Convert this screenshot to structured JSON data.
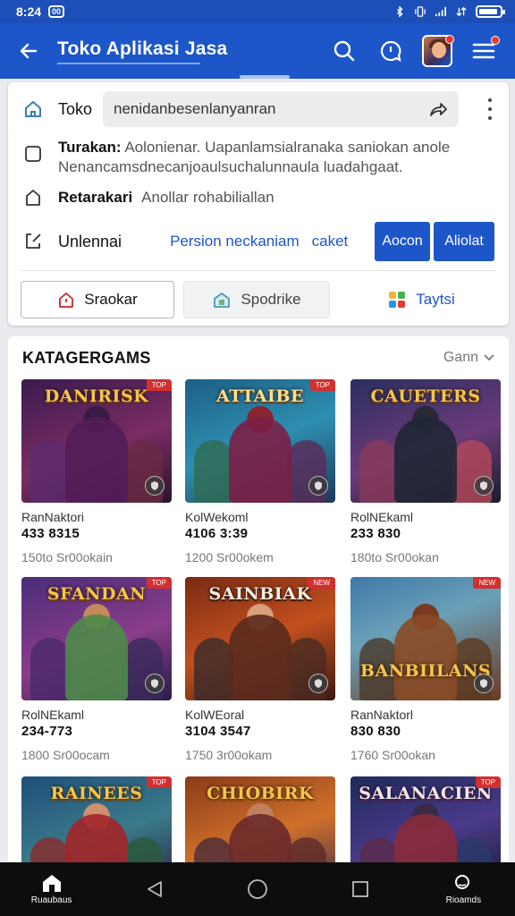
{
  "status_bar": {
    "time": "8:24",
    "badge": "00"
  },
  "app_bar": {
    "title": "Toko Aplikasi Jasa"
  },
  "search_row": {
    "label": "Toko",
    "query": "nenidanbesenlanyanran"
  },
  "info_row": {
    "title": "Turakan:",
    "text": "Aolonienar. Uapanlamsialranaka saniokan anole Nenancamsdnecanjoaulsuchalunnaula luadahgaat."
  },
  "rating_row": {
    "title": "Retarakari",
    "text": "Anollar rohabiliallan"
  },
  "action_row": {
    "label": "Unlennai",
    "link": "Persion neckaniam",
    "link2": "caket",
    "btn1": "Aocon",
    "btn2": "Aliolat"
  },
  "tabs": [
    {
      "label": "Sraokar"
    },
    {
      "label": "Spodrike"
    },
    {
      "label": "Taytsi"
    }
  ],
  "category": {
    "title": "KATAGERGAMS",
    "filter": "Gann",
    "items": [
      {
        "logo": "DANIRISK",
        "tag": "TOP",
        "name": "RanNaktori",
        "num": "433 8315",
        "meta": "150to   Sr00okain"
      },
      {
        "logo": "ATTAIBE",
        "tag": "TOP",
        "name": "KolWekoml",
        "num": "4106 3:39",
        "meta": "1200   Sr00okem"
      },
      {
        "logo": "CAUETERS",
        "tag": "",
        "name": "RolNEkaml",
        "num": "233 830",
        "meta": "180to   Sr00okan"
      },
      {
        "logo": "SFANDAN",
        "tag": "TOP",
        "name": "RolNEkaml",
        "num": "234-773",
        "meta": "1800   Sr00ocam"
      },
      {
        "logo": "SAINBIAK",
        "tag": "NEW",
        "name": "KolWEoral",
        "num": "3104 3547",
        "meta": "1750   3r00okam"
      },
      {
        "logo": "BANBIILANS",
        "tag": "NEW",
        "name": "RanNaktorl",
        "num": "830 830",
        "meta": "1760   Sr00okan"
      },
      {
        "logo": "RAINEES",
        "tag": "TOP",
        "name": "",
        "num": "",
        "meta": ""
      },
      {
        "logo": "CHIOBIRK",
        "tag": "",
        "name": "",
        "num": "",
        "meta": ""
      },
      {
        "logo": "SALANACIEN",
        "tag": "TOP",
        "name": "",
        "num": "",
        "meta": ""
      }
    ]
  },
  "nav": [
    {
      "label": "Ruaubaus",
      "icon": "home-icon"
    },
    {
      "label": "",
      "icon": "back-triangle-icon"
    },
    {
      "label": "",
      "icon": "home-circle-icon"
    },
    {
      "label": "",
      "icon": "recents-square-icon"
    },
    {
      "label": "Rioamds",
      "icon": "search-icon"
    }
  ]
}
